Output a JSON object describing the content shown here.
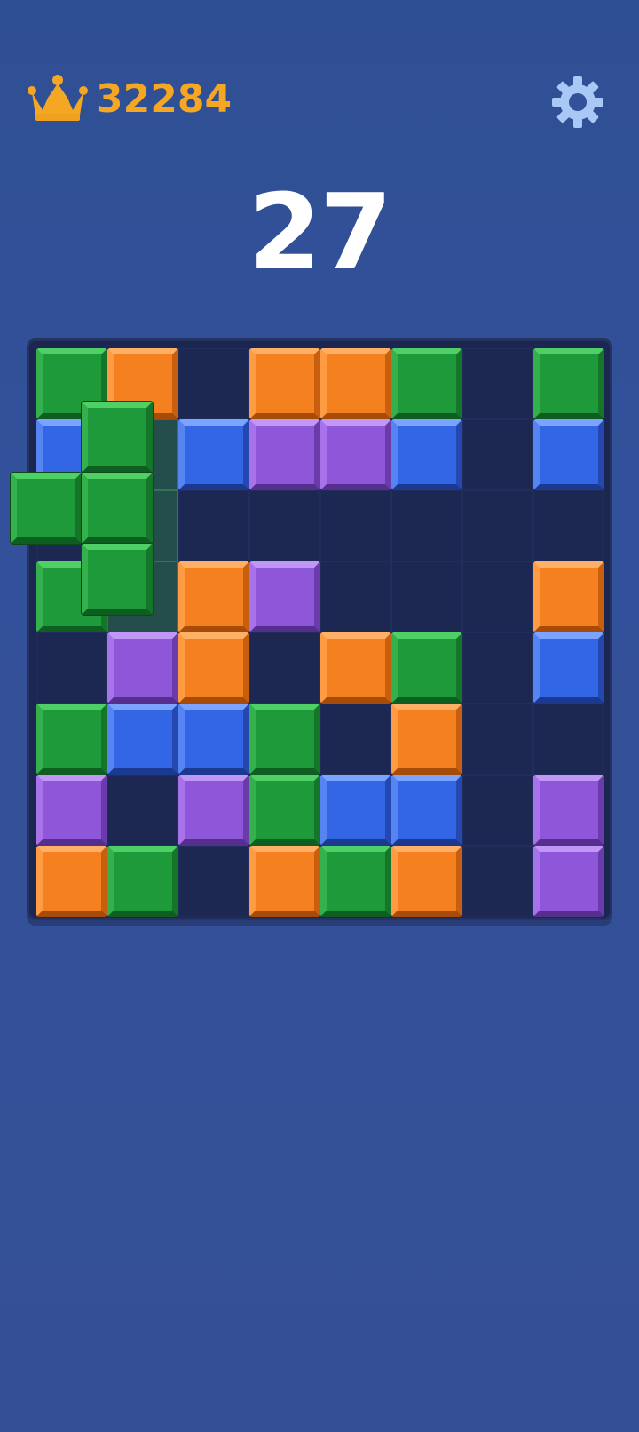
{
  "header": {
    "best_score": "32284",
    "crown_icon": "crown-icon",
    "settings_icon": "gear-icon"
  },
  "score": {
    "current": "27"
  },
  "colors": {
    "green": "#1f9a3a",
    "orange": "#f5801f",
    "blue": "#3366e4",
    "purple": "#8e56d8",
    "empty": "#1d2852",
    "score_gold": "#f5a623",
    "background": "#33519a"
  },
  "board": {
    "rows": [
      [
        "green",
        "orange",
        null,
        "orange",
        "orange",
        "green",
        null,
        "green"
      ],
      [
        "blue",
        "ghost",
        "blue",
        "purple",
        "purple",
        "blue",
        null,
        "blue"
      ],
      [
        null,
        "ghost",
        null,
        null,
        null,
        null,
        null,
        null
      ],
      [
        "green",
        "ghost",
        "orange",
        "purple",
        null,
        null,
        null,
        "orange"
      ],
      [
        null,
        "purple",
        "orange",
        null,
        "orange",
        "green",
        null,
        "blue"
      ],
      [
        "green",
        "blue",
        "blue",
        "green",
        null,
        "orange",
        null,
        null
      ],
      [
        "purple",
        null,
        "purple",
        "green",
        "blue",
        "blue",
        null,
        "purple"
      ],
      [
        "orange",
        "green",
        null,
        "orange",
        "green",
        "orange",
        null,
        "purple"
      ]
    ]
  },
  "dragging_piece": {
    "color": "green",
    "shape": "T-left",
    "cells": [
      [
        0,
        1
      ],
      [
        1,
        0
      ],
      [
        1,
        1
      ],
      [
        2,
        1
      ]
    ]
  }
}
